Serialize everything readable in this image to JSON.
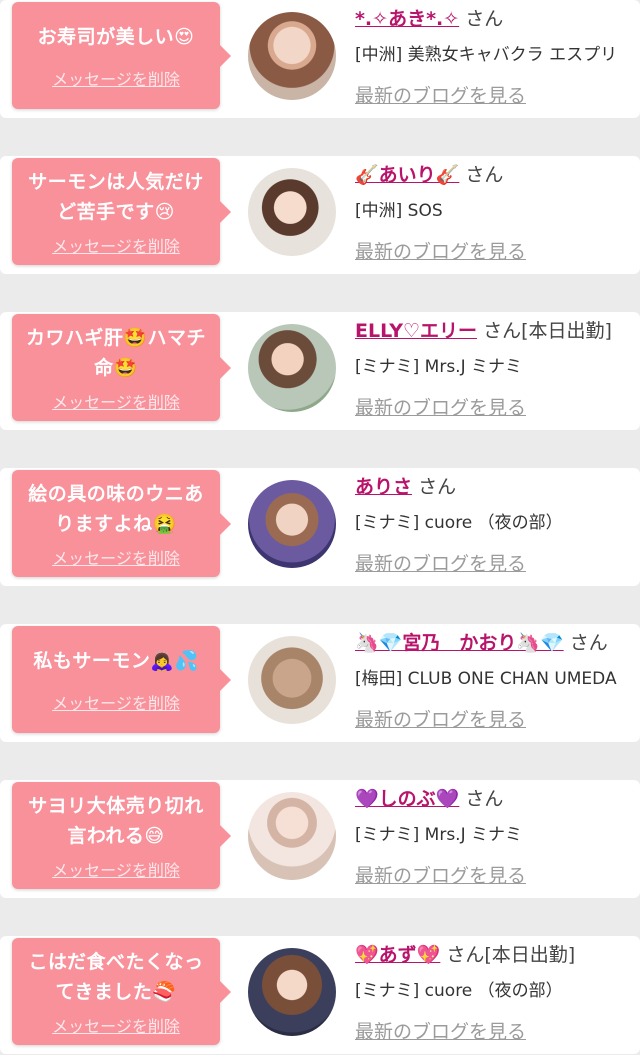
{
  "delete_label": "メッセージを削除",
  "blog_label": "最新のブログを見る",
  "san": "さん",
  "entries": [
    {
      "message_lines": [
        "お寿司が美しい😍"
      ],
      "name": "*.✧あき*.✧",
      "suffix": "さん",
      "shop": "[中洲] 美熟女キャバクラ エスプリ"
    },
    {
      "message_lines": [
        "サーモンは人気だけ",
        "ど苦手です😢"
      ],
      "name": "🎸あいり🎸",
      "suffix": "さん",
      "shop": "[中洲] SOS"
    },
    {
      "message_lines": [
        "カワハギ肝🤩ハマチ",
        "命🤩"
      ],
      "name": "ELLY♡エリー",
      "suffix": "さん[本日出勤]",
      "shop": "[ミナミ] Mrs.J ミナミ"
    },
    {
      "message_lines": [
        "絵の具の味のウニあ",
        "りますよね🤮"
      ],
      "name": "ありさ",
      "suffix": "さん",
      "shop": "[ミナミ] cuore （夜の部）"
    },
    {
      "message_lines": [
        "私もサーモン🙇‍♀️💦"
      ],
      "name": "🦄💎宮乃　かおり🦄💎",
      "suffix": "さん",
      "shop": "[梅田] CLUB ONE CHAN UMEDA"
    },
    {
      "message_lines": [
        "サヨリ大体売り切れ",
        "言われる😅"
      ],
      "name": "💜しのぶ💜",
      "suffix": "さん",
      "shop": "[ミナミ] Mrs.J ミナミ"
    },
    {
      "message_lines": [
        "こはだ食べたくなっ",
        "てきました🍣"
      ],
      "name": "💖あず💖",
      "suffix": "さん[本日出勤]",
      "shop": "[ミナミ] cuore （夜の部）"
    }
  ],
  "colors": {
    "bubble": "#f9919b",
    "name": "#b8146b",
    "link_gray": "#9b9b9b",
    "background": "#ebebeb"
  }
}
